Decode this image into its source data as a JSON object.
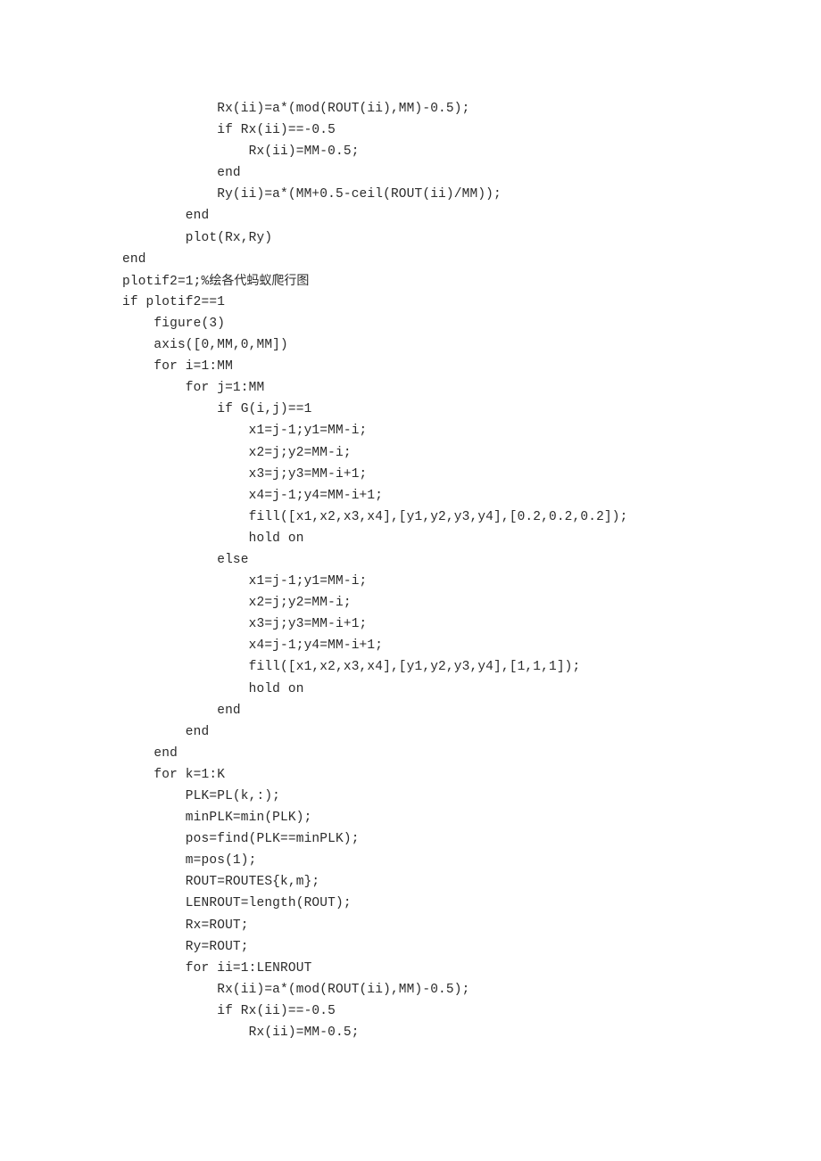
{
  "document": {
    "type": "source-code-listing",
    "language": "MATLAB",
    "page_background": "#ffffff",
    "text_color": "#2b2b2b",
    "comment_text": "绘各代蚂蚁爬行图",
    "lines": [
      "            Rx(ii)=a*(mod(ROUT(ii),MM)-0.5);",
      "            if Rx(ii)==-0.5",
      "                Rx(ii)=MM-0.5;",
      "            end",
      "            Ry(ii)=a*(MM+0.5-ceil(ROUT(ii)/MM));",
      "        end",
      "        plot(Rx,Ry)",
      "end",
      "plotif2=1;%绘各代蚂蚁爬行图",
      "if plotif2==1",
      "    figure(3)",
      "    axis([0,MM,0,MM])",
      "    for i=1:MM",
      "        for j=1:MM",
      "            if G(i,j)==1",
      "                x1=j-1;y1=MM-i;",
      "                x2=j;y2=MM-i;",
      "                x3=j;y3=MM-i+1;",
      "                x4=j-1;y4=MM-i+1;",
      "                fill([x1,x2,x3,x4],[y1,y2,y3,y4],[0.2,0.2,0.2]);",
      "                hold on",
      "            else",
      "                x1=j-1;y1=MM-i;",
      "                x2=j;y2=MM-i;",
      "                x3=j;y3=MM-i+1;",
      "                x4=j-1;y4=MM-i+1;",
      "                fill([x1,x2,x3,x4],[y1,y2,y3,y4],[1,1,1]);",
      "                hold on",
      "            end",
      "        end",
      "    end",
      "    for k=1:K",
      "        PLK=PL(k,:);",
      "        minPLK=min(PLK);",
      "        pos=find(PLK==minPLK);",
      "        m=pos(1);",
      "        ROUT=ROUTES{k,m};",
      "        LENROUT=length(ROUT);",
      "        Rx=ROUT;",
      "        Ry=ROUT;",
      "        for ii=1:LENROUT",
      "            Rx(ii)=a*(mod(ROUT(ii),MM)-0.5);",
      "            if Rx(ii)==-0.5",
      "                Rx(ii)=MM-0.5;"
    ]
  }
}
